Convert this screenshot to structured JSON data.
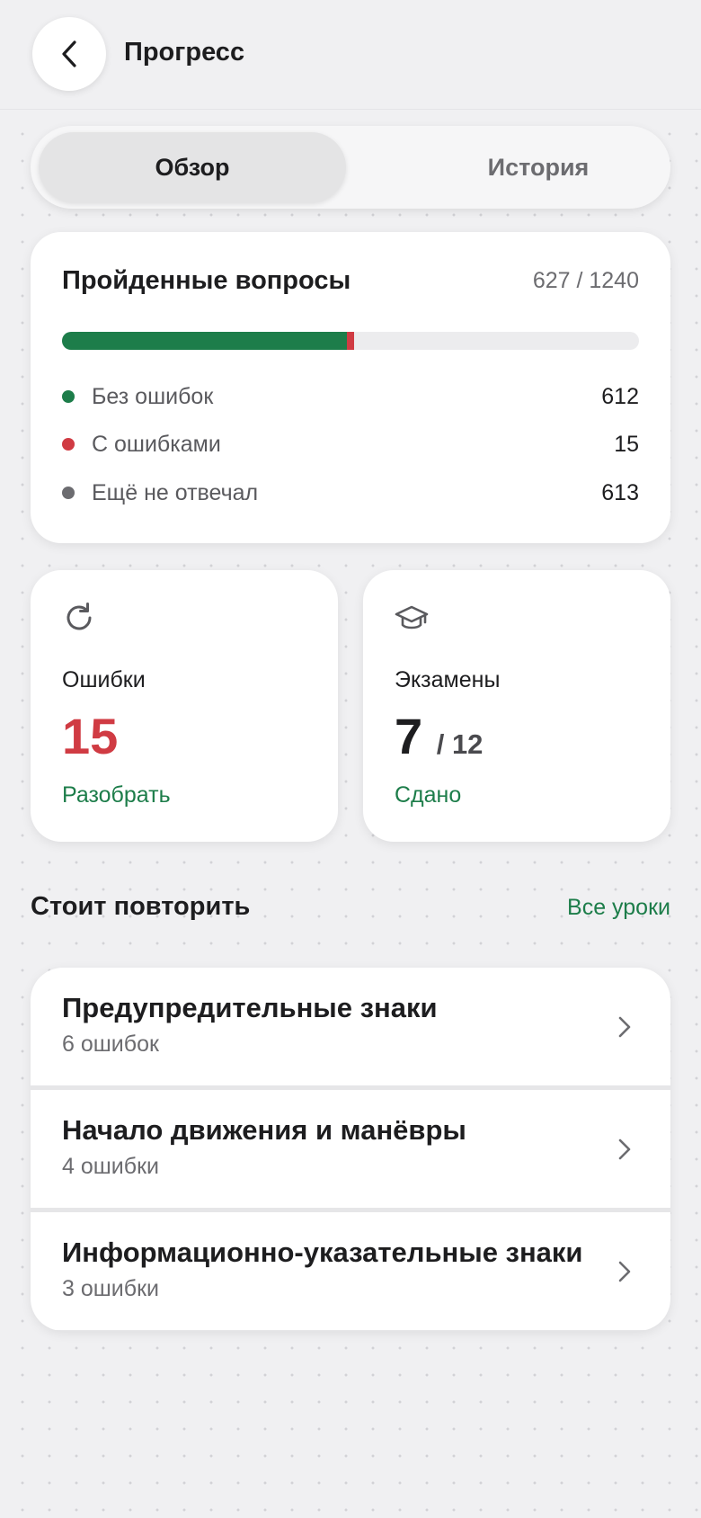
{
  "header": {
    "title": "Прогресс",
    "back_icon": "chevron-left-icon"
  },
  "tabs": [
    {
      "label": "Обзор",
      "active": true
    },
    {
      "label": "История",
      "active": false
    }
  ],
  "answered": {
    "title": "Пройденные вопросы",
    "count": "627 / 1240",
    "progress": {
      "correct_fraction": 0.4935,
      "wrong_fraction": 0.0121
    },
    "legend": [
      {
        "label": "Без ошибок",
        "value": "612",
        "color": "#1d7d4a"
      },
      {
        "label": "С ошибками",
        "value": "15",
        "color": "#d03b43"
      },
      {
        "label": "Ещё не отвечал",
        "value": "613",
        "color": "#6c6c70"
      }
    ]
  },
  "mistakes_card": {
    "icon": "refresh-icon",
    "label": "Ошибки",
    "value": "15",
    "value_color": "#d03b43",
    "link": "Разобрать"
  },
  "exams_card": {
    "icon": "graduation-cap-icon",
    "label": "Экзамены",
    "value": "7",
    "total": "/ 12",
    "link": "Сдано"
  },
  "review": {
    "title": "Стоит повторить",
    "link": "Все уроки",
    "items": [
      {
        "title": "Предупредительные знаки",
        "subtitle": "6 ошибок"
      },
      {
        "title": "Начало движения и манёвры",
        "subtitle": "4 ошибки"
      },
      {
        "title": "Информационно-указательные знаки",
        "subtitle": "3 ошибки"
      }
    ]
  },
  "colors": {
    "accent": "#1d7d4a",
    "error": "#d03b43",
    "neutral": "#6c6c70"
  }
}
